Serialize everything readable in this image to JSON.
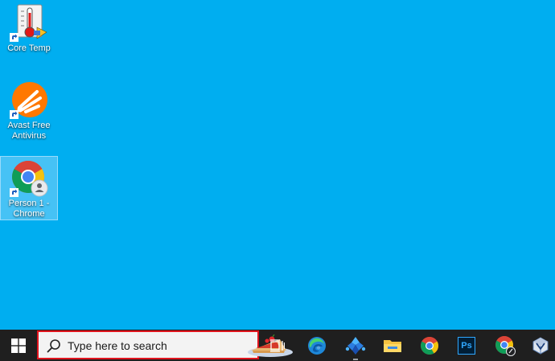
{
  "desktop": {
    "background_color": "#00aef0",
    "icons": [
      {
        "label": "Core Temp",
        "icon": "thermometer-icon"
      },
      {
        "label": "Avast Free\nAntivirus",
        "icon": "avast-icon"
      },
      {
        "label": "Person 1 -\nChrome",
        "icon": "chrome-profile-icon",
        "selected": true
      }
    ]
  },
  "taskbar": {
    "background_color": "#1f1f1f",
    "start_icon": "windows-logo-icon",
    "search": {
      "placeholder": "Type here to search",
      "highlight_color": "#e0141e"
    },
    "apps": [
      {
        "name": "task-view",
        "icon": "task-view-icon"
      },
      {
        "name": "edge",
        "icon": "edge-icon"
      },
      {
        "name": "copilot-app",
        "icon": "app-icon"
      },
      {
        "name": "file-explorer",
        "icon": "folder-icon"
      },
      {
        "name": "chrome",
        "icon": "chrome-icon"
      },
      {
        "name": "photoshop",
        "icon": "photoshop-icon",
        "text": "Ps"
      },
      {
        "name": "chrome-profile",
        "icon": "chrome-profile-icon"
      },
      {
        "name": "virtualbox",
        "icon": "virtualbox-icon"
      }
    ]
  }
}
